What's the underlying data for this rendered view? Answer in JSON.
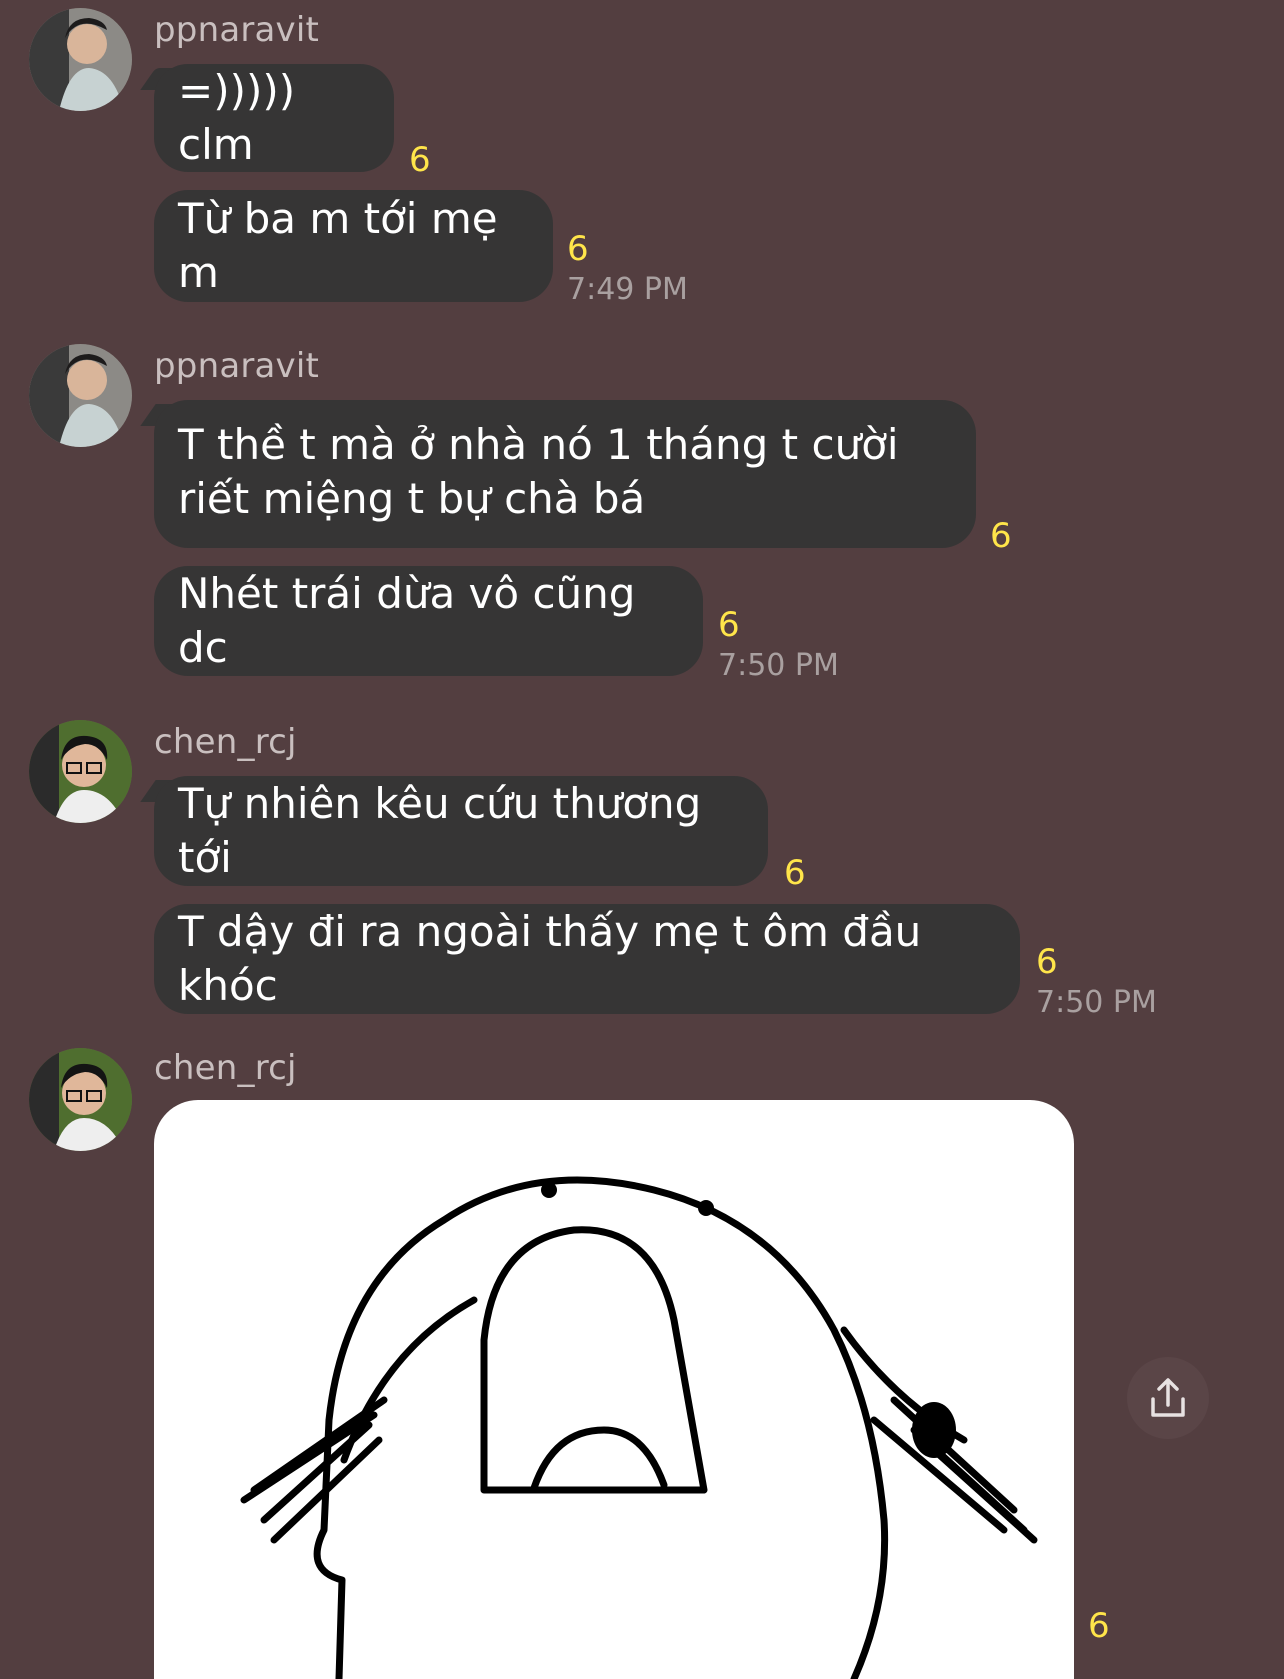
{
  "groups": [
    {
      "username": "ppnaravit",
      "avatar_icon": "avatar-ppnaravit",
      "messages": [
        {
          "text": "=))))) clm",
          "reaction_count": "6"
        },
        {
          "text": "Từ ba m tới mẹ m",
          "reaction_count": "6",
          "time": "7:49 PM"
        }
      ]
    },
    {
      "username": "ppnaravit",
      "avatar_icon": "avatar-ppnaravit",
      "messages": [
        {
          "text": "T thề t mà ở nhà nó 1 tháng t cười riết miệng t bự chà bá",
          "reaction_count": "6"
        },
        {
          "text": "Nhét trái dừa vô cũng dc",
          "reaction_count": "6",
          "time": "7:50 PM"
        }
      ]
    },
    {
      "username": "chen_rcj",
      "avatar_icon": "avatar-chen-rcj",
      "messages": [
        {
          "text": "Tự nhiên kêu cứu thương tới",
          "reaction_count": "6"
        },
        {
          "text": "T dậy đi ra ngoài thấy mẹ t ôm đầu khóc",
          "reaction_count": "6",
          "time": "7:50 PM"
        }
      ]
    },
    {
      "username": "chen_rcj",
      "avatar_icon": "avatar-chen-rcj",
      "messages": [
        {
          "type": "image",
          "image_icon": "screaming-blob-sticker",
          "reaction_count": "6"
        }
      ]
    }
  ],
  "share_icon": "share-icon"
}
